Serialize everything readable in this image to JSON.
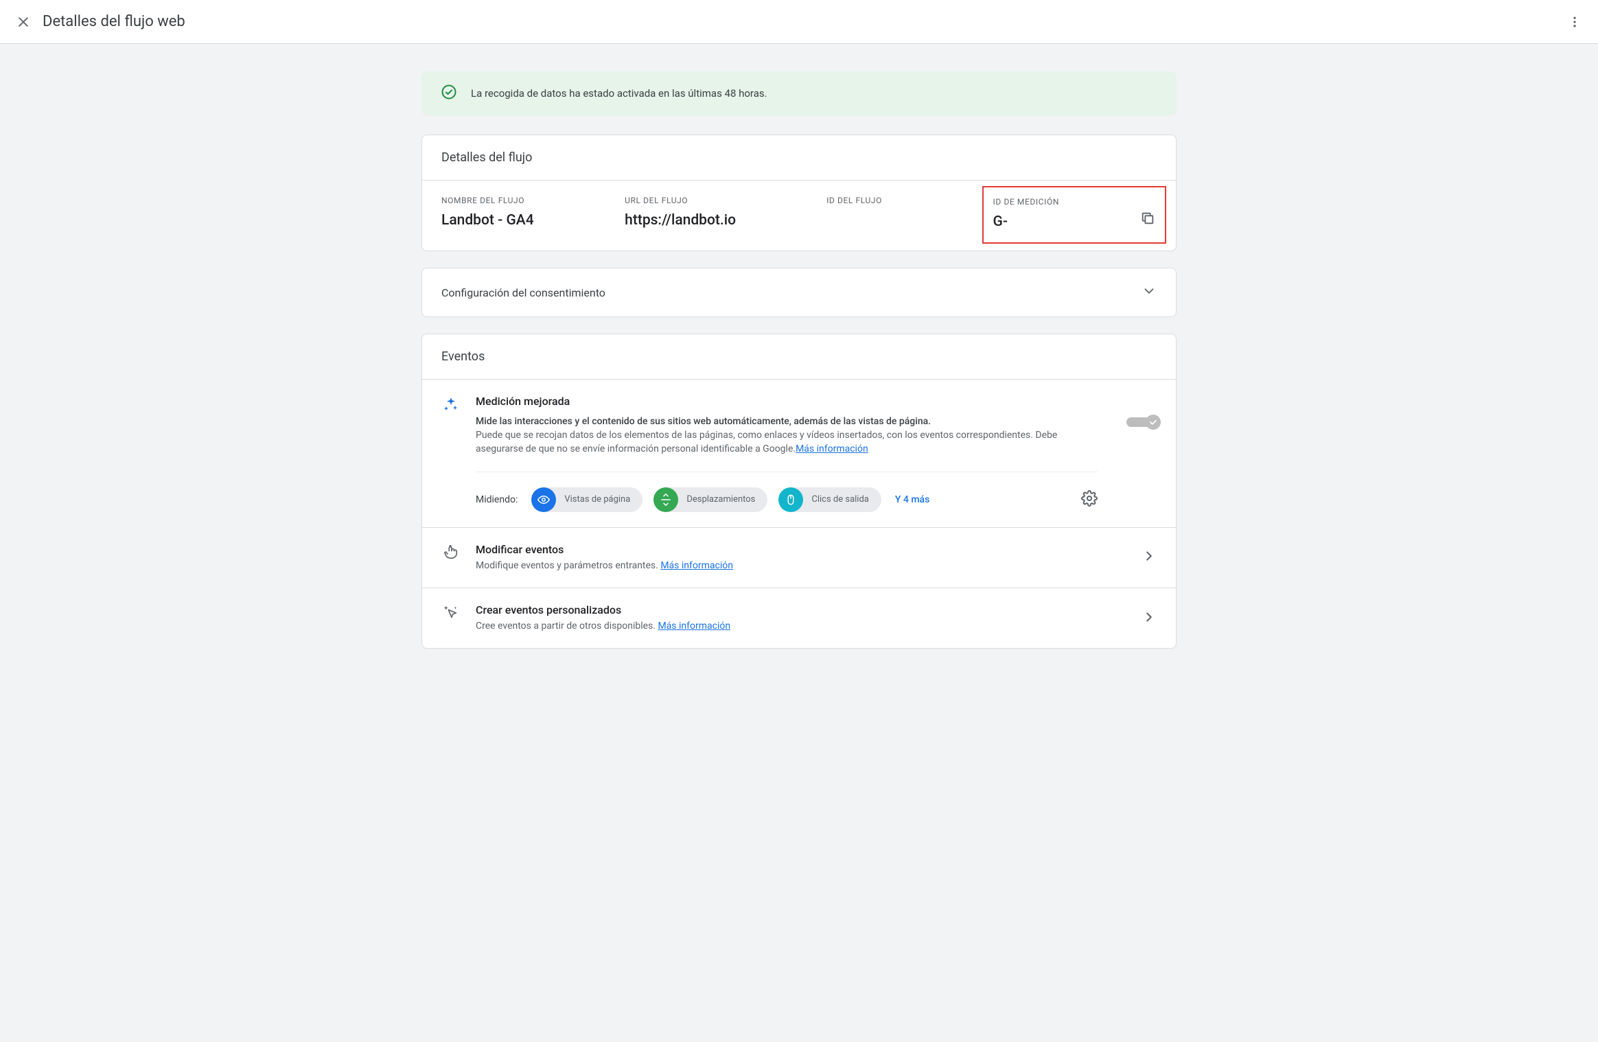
{
  "header": {
    "title": "Detalles del flujo web"
  },
  "banner": {
    "text": "La recogida de datos ha estado activada en las últimas 48 horas."
  },
  "details": {
    "title": "Detalles del flujo",
    "name_label": "NOMBRE DEL FLUJO",
    "name_value": "Landbot - GA4",
    "url_label": "URL DEL FLUJO",
    "url_value": "https://landbot.io",
    "id_label": "ID DEL FLUJO",
    "id_value": "",
    "measurement_label": "ID DE MEDICIÓN",
    "measurement_value": "G-"
  },
  "consent": {
    "title": "Configuración del consentimiento"
  },
  "events": {
    "title": "Eventos",
    "enhanced": {
      "title": "Medición mejorada",
      "sub": "Mide las interacciones y el contenido de sus sitios web automáticamente, además de las vistas de página.",
      "desc": "Puede que se recojan datos de los elementos de las páginas, como enlaces y vídeos insertados, con los eventos correspondientes. Debe asegurarse de que no se envíe información personal identificable a Google.",
      "link": "Más información",
      "measuring_label": "Midiendo:",
      "chips": {
        "0": "Vistas de página",
        "1": "Desplazamientos",
        "2": "Clics de salida"
      },
      "more": "Y 4 más"
    },
    "modify": {
      "title": "Modificar eventos",
      "desc": "Modifique eventos y parámetros entrantes. ",
      "link": "Más información"
    },
    "create": {
      "title": "Crear eventos personalizados",
      "desc": "Cree eventos a partir de otros disponibles. ",
      "link": "Más información"
    }
  }
}
